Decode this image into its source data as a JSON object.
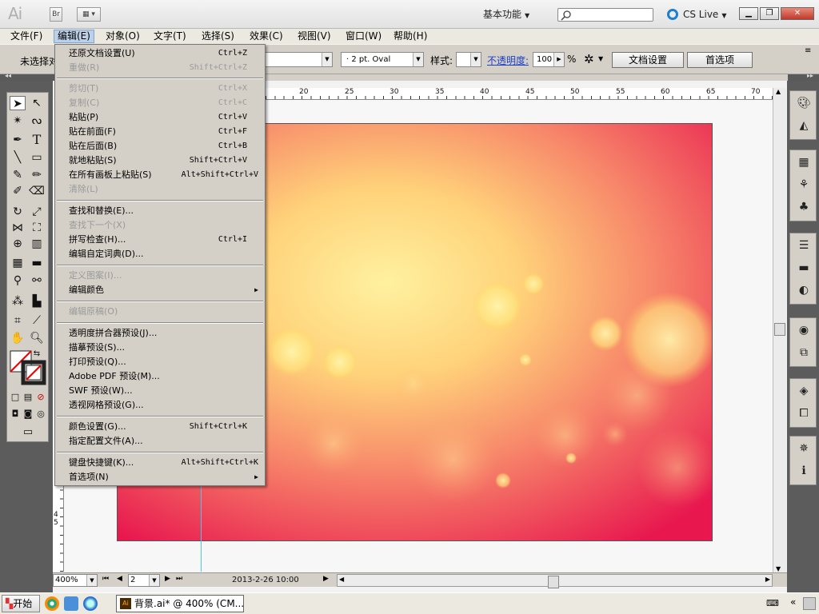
{
  "app": {
    "logo": "Ai",
    "bridge_label": "Br",
    "workspace": "基本功能",
    "cslive": "CS Live"
  },
  "menubar": [
    {
      "label": "文件(F)"
    },
    {
      "label": "编辑(E)"
    },
    {
      "label": "对象(O)"
    },
    {
      "label": "文字(T)"
    },
    {
      "label": "选择(S)"
    },
    {
      "label": "效果(C)"
    },
    {
      "label": "视图(V)"
    },
    {
      "label": "窗口(W)"
    },
    {
      "label": "帮助(H)"
    }
  ],
  "control": {
    "selection": "未选择对象",
    "stroke_profile": "2 pt. Oval",
    "style_label": "样式:",
    "opacity_label": "不透明度:",
    "opacity_value": "100",
    "opacity_unit": "%",
    "doc_settings": "文档设置",
    "preferences": "首选项"
  },
  "edit_menu": [
    {
      "label": "还原文档设置(U)",
      "shortcut": "Ctrl+Z",
      "disabled": false
    },
    {
      "label": "重做(R)",
      "shortcut": "Shift+Ctrl+Z",
      "disabled": true
    },
    {
      "label": "剪切(T)",
      "shortcut": "Ctrl+X",
      "disabled": true
    },
    {
      "label": "复制(C)",
      "shortcut": "Ctrl+C",
      "disabled": true
    },
    {
      "label": "粘贴(P)",
      "shortcut": "Ctrl+V",
      "disabled": false
    },
    {
      "label": "贴在前面(F)",
      "shortcut": "Ctrl+F",
      "disabled": false
    },
    {
      "label": "贴在后面(B)",
      "shortcut": "Ctrl+B",
      "disabled": false
    },
    {
      "label": "就地粘贴(S)",
      "shortcut": "Shift+Ctrl+V",
      "disabled": false
    },
    {
      "label": "在所有画板上粘贴(S)",
      "shortcut": "Alt+Shift+Ctrl+V",
      "disabled": false
    },
    {
      "label": "清除(L)",
      "shortcut": "",
      "disabled": true
    },
    {
      "label": "查找和替换(E)...",
      "shortcut": "",
      "disabled": false
    },
    {
      "label": "查找下一个(X)",
      "shortcut": "",
      "disabled": true
    },
    {
      "label": "拼写检查(H)...",
      "shortcut": "Ctrl+I",
      "disabled": false
    },
    {
      "label": "编辑自定词典(D)...",
      "shortcut": "",
      "disabled": false
    },
    {
      "label": "定义图案(I)...",
      "shortcut": "",
      "disabled": true
    },
    {
      "label": "编辑颜色",
      "shortcut": "",
      "disabled": false
    },
    {
      "label": "编辑原稿(O)",
      "shortcut": "",
      "disabled": true
    },
    {
      "label": "透明度拼合器预设(J)...",
      "shortcut": "",
      "disabled": false
    },
    {
      "label": "描摹预设(S)...",
      "shortcut": "",
      "disabled": false
    },
    {
      "label": "打印预设(Q)...",
      "shortcut": "",
      "disabled": false
    },
    {
      "label": "Adobe PDF 预设(M)...",
      "shortcut": "",
      "disabled": false
    },
    {
      "label": "SWF 预设(W)...",
      "shortcut": "",
      "disabled": false
    },
    {
      "label": "透视网格预设(G)...",
      "shortcut": "",
      "disabled": false
    },
    {
      "label": "颜色设置(G)...",
      "shortcut": "Shift+Ctrl+K",
      "disabled": false
    },
    {
      "label": "指定配置文件(A)...",
      "shortcut": "",
      "disabled": false
    },
    {
      "label": "键盘快捷键(K)...",
      "shortcut": "Alt+Shift+Ctrl+K",
      "disabled": false
    },
    {
      "label": "首选项(N)",
      "shortcut": "",
      "disabled": false
    }
  ],
  "ruler": {
    "top": [
      "20",
      "25",
      "30",
      "35",
      "40",
      "45",
      "50",
      "55",
      "60",
      "65",
      "70"
    ],
    "left": [
      "4",
      "5"
    ]
  },
  "status": {
    "zoom": "400%",
    "page": "2",
    "info": "2013-2-26  10:00"
  },
  "taskbar": {
    "start": "开始",
    "doc": "背景.ai* @ 400% (CM..."
  },
  "colors": {
    "artboard_edge": "#e8184f",
    "artboard_glow": "#ffe27a"
  }
}
